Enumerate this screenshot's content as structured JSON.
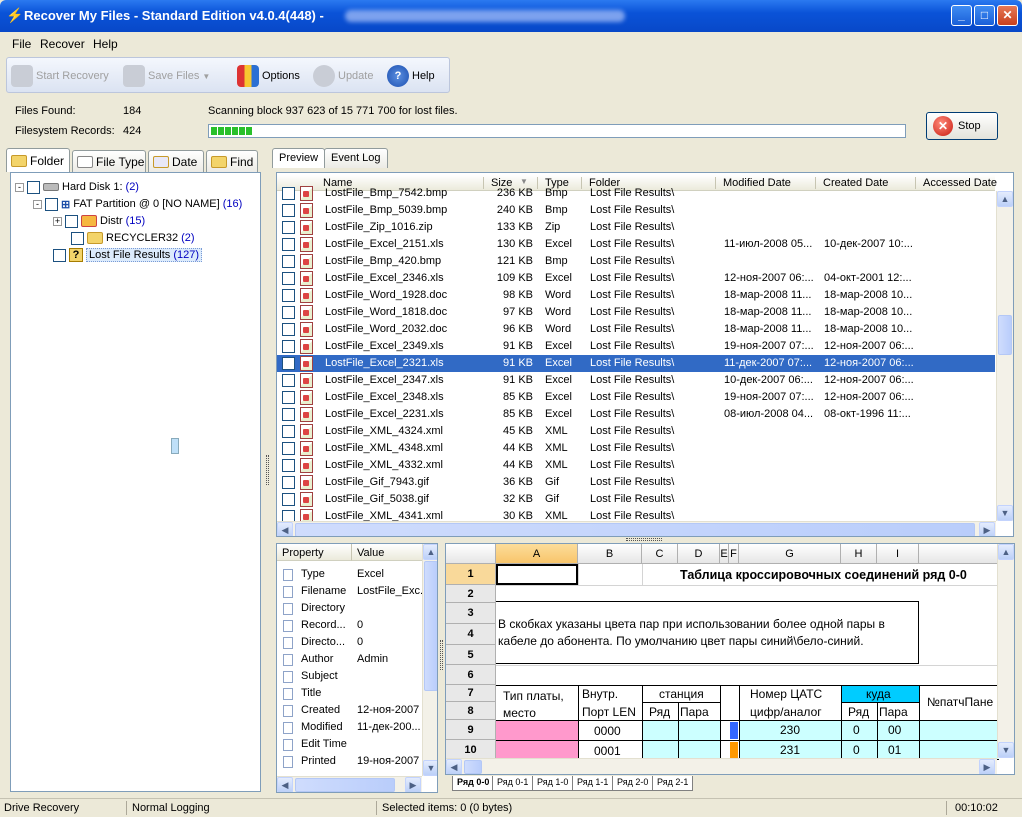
{
  "window": {
    "title": "Recover My Files - Standard Edition v4.0.4(448)  -"
  },
  "menu": [
    "File",
    "Recover",
    "Help"
  ],
  "toolbar": {
    "start_recovery": "Start Recovery",
    "save_files": "Save Files",
    "options": "Options",
    "update": "Update",
    "help": "Help"
  },
  "scan": {
    "files_found_label": "Files Found:",
    "files_found_value": "184",
    "fs_records_label": "Filesystem Records:",
    "fs_records_value": "424",
    "scanning_text": "Scanning block 937 623 of 15 771 700 for lost files.",
    "stop_label": "Stop",
    "progress_fraction": 0.06
  },
  "left_tabs": [
    "Folder",
    "File Type",
    "Date",
    "Find"
  ],
  "tree": [
    {
      "label": "Hard Disk 1:",
      "count": "(2)"
    },
    {
      "label": "FAT Partition @ 0 [NO NAME]",
      "count": "(16)"
    },
    {
      "label": "Distr",
      "count": "(15)"
    },
    {
      "label": "RECYCLER32",
      "count": "(2)"
    },
    {
      "label": "Lost File Results",
      "count": "(127)"
    }
  ],
  "right_tabs": [
    "Preview",
    "Event Log"
  ],
  "grid": {
    "columns": [
      "Name",
      "Size",
      "Type",
      "Folder",
      "Modified Date",
      "Created Date",
      "Accessed Date"
    ],
    "rows": [
      {
        "name": "LostFile_Bmp_7542.bmp",
        "size": "236 KB",
        "type": "Bmp",
        "folder": "Lost File Results\\",
        "modified": "",
        "created": ""
      },
      {
        "name": "LostFile_Bmp_5039.bmp",
        "size": "240 KB",
        "type": "Bmp",
        "folder": "Lost File Results\\",
        "modified": "",
        "created": ""
      },
      {
        "name": "LostFile_Zip_1016.zip",
        "size": "133 KB",
        "type": "Zip",
        "folder": "Lost File Results\\",
        "modified": "",
        "created": ""
      },
      {
        "name": "LostFile_Excel_2151.xls",
        "size": "130 KB",
        "type": "Excel",
        "folder": "Lost File Results\\",
        "modified": "11-июл-2008 05...",
        "created": "10-дек-2007 10:..."
      },
      {
        "name": "LostFile_Bmp_420.bmp",
        "size": "121 KB",
        "type": "Bmp",
        "folder": "Lost File Results\\",
        "modified": "",
        "created": ""
      },
      {
        "name": "LostFile_Excel_2346.xls",
        "size": "109 KB",
        "type": "Excel",
        "folder": "Lost File Results\\",
        "modified": "12-ноя-2007 06:...",
        "created": "04-окт-2001 12:..."
      },
      {
        "name": "LostFile_Word_1928.doc",
        "size": "98 KB",
        "type": "Word",
        "folder": "Lost File Results\\",
        "modified": "18-мар-2008 11...",
        "created": "18-мар-2008 10..."
      },
      {
        "name": "LostFile_Word_1818.doc",
        "size": "97 KB",
        "type": "Word",
        "folder": "Lost File Results\\",
        "modified": "18-мар-2008 11...",
        "created": "18-мар-2008 10..."
      },
      {
        "name": "LostFile_Word_2032.doc",
        "size": "96 KB",
        "type": "Word",
        "folder": "Lost File Results\\",
        "modified": "18-мар-2008 11...",
        "created": "18-мар-2008 10..."
      },
      {
        "name": "LostFile_Excel_2349.xls",
        "size": "91 KB",
        "type": "Excel",
        "folder": "Lost File Results\\",
        "modified": "19-ноя-2007 07:...",
        "created": "12-ноя-2007 06:..."
      },
      {
        "name": "LostFile_Excel_2321.xls",
        "size": "91 KB",
        "type": "Excel",
        "folder": "Lost File Results\\",
        "modified": "11-дек-2007 07:...",
        "created": "12-ноя-2007 06:...",
        "selected": true
      },
      {
        "name": "LostFile_Excel_2347.xls",
        "size": "91 KB",
        "type": "Excel",
        "folder": "Lost File Results\\",
        "modified": "10-дек-2007 06:...",
        "created": "12-ноя-2007 06:..."
      },
      {
        "name": "LostFile_Excel_2348.xls",
        "size": "85 KB",
        "type": "Excel",
        "folder": "Lost File Results\\",
        "modified": "19-ноя-2007 07:...",
        "created": "12-ноя-2007 06:..."
      },
      {
        "name": "LostFile_Excel_2231.xls",
        "size": "85 KB",
        "type": "Excel",
        "folder": "Lost File Results\\",
        "modified": "08-июл-2008 04...",
        "created": "08-окт-1996 11:..."
      },
      {
        "name": "LostFile_XML_4324.xml",
        "size": "45 KB",
        "type": "XML",
        "folder": "Lost File Results\\",
        "modified": "",
        "created": ""
      },
      {
        "name": "LostFile_XML_4348.xml",
        "size": "44 KB",
        "type": "XML",
        "folder": "Lost File Results\\",
        "modified": "",
        "created": ""
      },
      {
        "name": "LostFile_XML_4332.xml",
        "size": "44 KB",
        "type": "XML",
        "folder": "Lost File Results\\",
        "modified": "",
        "created": ""
      },
      {
        "name": "LostFile_Gif_7943.gif",
        "size": "36 KB",
        "type": "Gif",
        "folder": "Lost File Results\\",
        "modified": "",
        "created": ""
      },
      {
        "name": "LostFile_Gif_5038.gif",
        "size": "32 KB",
        "type": "Gif",
        "folder": "Lost File Results\\",
        "modified": "",
        "created": ""
      },
      {
        "name": "LostFile_XML_4341.xml",
        "size": "30 KB",
        "type": "XML",
        "folder": "Lost File Results\\",
        "modified": "",
        "created": ""
      }
    ]
  },
  "properties": {
    "headers": [
      "Property",
      "Value"
    ],
    "rows": [
      {
        "name": "Type",
        "value": "Excel"
      },
      {
        "name": "Filename",
        "value": "LostFile_Exc..."
      },
      {
        "name": "Directory",
        "value": ""
      },
      {
        "name": "Record...",
        "value": "0"
      },
      {
        "name": "Directo...",
        "value": "0"
      },
      {
        "name": "Author",
        "value": "Admin"
      },
      {
        "name": "Subject",
        "value": ""
      },
      {
        "name": "Title",
        "value": ""
      },
      {
        "name": "Created",
        "value": "12-ноя-2007"
      },
      {
        "name": "Modified",
        "value": "11-дек-200..."
      },
      {
        "name": "Edit Time",
        "value": ""
      },
      {
        "name": "Printed",
        "value": "19-ноя-2007"
      }
    ]
  },
  "sheet": {
    "columns": [
      "A",
      "B",
      "C",
      "D",
      "E",
      "F",
      "G",
      "H",
      "I"
    ],
    "rows": [
      "1",
      "2",
      "3",
      "4",
      "5",
      "6",
      "7",
      "8",
      "9",
      "10"
    ],
    "title": "Таблица кроссировочных соединений ряд 0-0",
    "note_line1": "В скобках указаны цвета пар при использовании более одной пары в",
    "note_line2": "кабеле до абонента. По умолчанию цвет пары синий\\бело-синий.",
    "h_board": "Тип платы,",
    "h_board2": "место",
    "h_inner": "Внутр.",
    "h_inner2": "Порт LEN",
    "h_station": "станция",
    "h_row": "Ряд",
    "h_pair": "Пара",
    "h_number": "Номер ЦАТС",
    "h_number2": "цифр/аналог",
    "h_where": "куда",
    "h_row2": "Ряд",
    "h_pair2": "Пара",
    "h_patch": "№патчПане",
    "r9_port": "0000",
    "r9_num": "230",
    "r9_row": "0",
    "r9_pair": "00",
    "r10_port": "0001",
    "r10_num": "231",
    "r10_row": "0",
    "r10_pair": "01"
  },
  "sheet_tabs": [
    "Ряд 0-0",
    "Ряд 0-1",
    "Ряд 1-0",
    "Ряд 1-1",
    "Ряд 2-0",
    "Ряд 2-1"
  ],
  "statusbar": {
    "mode": "Drive Recovery",
    "logging": "Normal Logging",
    "selected": "Selected items: 0 (0 bytes)",
    "time": "00:10:02"
  }
}
